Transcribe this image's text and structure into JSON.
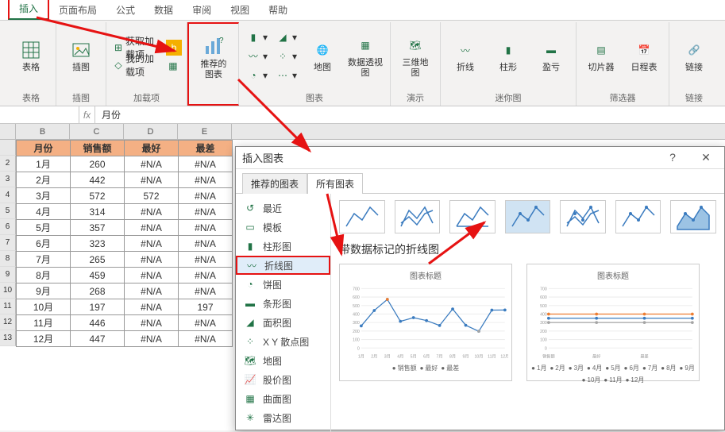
{
  "ribbon": {
    "tabs": [
      "插入",
      "页面布局",
      "公式",
      "数据",
      "审阅",
      "视图",
      "帮助"
    ],
    "activeTab": "插入",
    "groups": {
      "table": {
        "label": "表格",
        "btn": "表格"
      },
      "illus": {
        "label": "插图",
        "btn": "插图"
      },
      "addins": {
        "label": "加载项",
        "item1": "获取加载项",
        "item2": "我的加载项"
      },
      "rec": {
        "label": "推荐的图表",
        "btn": "推荐的\n图表"
      },
      "charts": {
        "label": "图表",
        "btn": "地图",
        "btn2": "数据透视图"
      },
      "demo": {
        "label": "演示",
        "btn": "三维地\n图"
      },
      "spark": {
        "label": "迷你图",
        "b1": "折线",
        "b2": "柱形",
        "b3": "盈亏"
      },
      "filter": {
        "label": "筛选器",
        "b1": "切片器",
        "b2": "日程表"
      },
      "link": {
        "label": "链接",
        "btn": "链接"
      }
    }
  },
  "formula": {
    "cell": "",
    "fx": "fx",
    "value": "月份"
  },
  "colHeaders": [
    "B",
    "C",
    "D",
    "E"
  ],
  "table": {
    "headers": [
      "月份",
      "销售额",
      "最好",
      "最差"
    ],
    "rows": [
      [
        "1月",
        "260",
        "#N/A",
        "#N/A"
      ],
      [
        "2月",
        "442",
        "#N/A",
        "#N/A"
      ],
      [
        "3月",
        "572",
        "572",
        "#N/A"
      ],
      [
        "4月",
        "314",
        "#N/A",
        "#N/A"
      ],
      [
        "5月",
        "357",
        "#N/A",
        "#N/A"
      ],
      [
        "6月",
        "323",
        "#N/A",
        "#N/A"
      ],
      [
        "7月",
        "265",
        "#N/A",
        "#N/A"
      ],
      [
        "8月",
        "459",
        "#N/A",
        "#N/A"
      ],
      [
        "9月",
        "268",
        "#N/A",
        "#N/A"
      ],
      [
        "10月",
        "197",
        "#N/A",
        "197"
      ],
      [
        "11月",
        "446",
        "#N/A",
        "#N/A"
      ],
      [
        "12月",
        "447",
        "#N/A",
        "#N/A"
      ]
    ]
  },
  "dialog": {
    "title": "插入图表",
    "tabRec": "推荐的图表",
    "tabAll": "所有图表",
    "nav": [
      "最近",
      "模板",
      "柱形图",
      "折线图",
      "饼图",
      "条形图",
      "面积图",
      "X Y 散点图",
      "地图",
      "股价图",
      "曲面图",
      "雷达图"
    ],
    "subtypeTitle": "带数据标记的折线图",
    "previewTitle": "图表标题",
    "legend1": [
      "销售额",
      "最好",
      "最差"
    ],
    "legend2": [
      "1月",
      "2月",
      "3月",
      "4月",
      "5月",
      "6月",
      "7月",
      "8月",
      "9月",
      "10月",
      "11月",
      "12月"
    ],
    "xlabels": [
      "1月",
      "2月",
      "3月",
      "4月",
      "5月",
      "6月",
      "7月",
      "8月",
      "9月",
      "10月",
      "11月",
      "12月"
    ]
  },
  "chart_data": {
    "type": "line",
    "title": "图表标题",
    "categories": [
      "1月",
      "2月",
      "3月",
      "4月",
      "5月",
      "6月",
      "7月",
      "8月",
      "9月",
      "10月",
      "11月",
      "12月"
    ],
    "series": [
      {
        "name": "销售额",
        "values": [
          260,
          442,
          572,
          314,
          357,
          323,
          265,
          459,
          268,
          197,
          446,
          447
        ]
      },
      {
        "name": "最好",
        "values": [
          null,
          null,
          572,
          null,
          null,
          null,
          null,
          null,
          null,
          null,
          null,
          null
        ]
      },
      {
        "name": "最差",
        "values": [
          null,
          null,
          null,
          null,
          null,
          null,
          null,
          null,
          null,
          197,
          null,
          null
        ]
      }
    ],
    "ylim": [
      0,
      700
    ],
    "yticks": [
      0,
      100,
      200,
      300,
      400,
      500,
      600,
      700
    ]
  }
}
